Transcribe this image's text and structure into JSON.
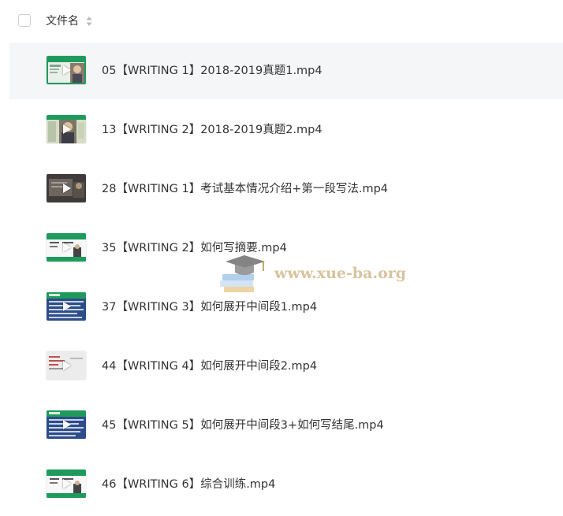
{
  "header": {
    "column_title": "文件名"
  },
  "files": [
    {
      "name": "05【WRITING 1】2018-2019真题1.mp4"
    },
    {
      "name": "13【WRITING 2】2018-2019真题2.mp4"
    },
    {
      "name": "28【WRITING 1】考试基本情况介绍+第一段写法.mp4"
    },
    {
      "name": "35【WRITING 2】如何写摘要.mp4"
    },
    {
      "name": "37【WRITING 3】如何展开中间段1.mp4"
    },
    {
      "name": "44【WRITING 4】如何展开中间段2.mp4"
    },
    {
      "name": "45【WRITING 5】如何展开中间段3+如何写结尾.mp4"
    },
    {
      "name": "46【WRITING 6】综合训练.mp4"
    }
  ],
  "watermark": {
    "text": "www.xue-ba.org"
  },
  "colors": {
    "hover_row": "#f5f6f8",
    "text": "#333333",
    "thumb_green": "#1e9b5c",
    "watermark": "#d1b98d"
  }
}
